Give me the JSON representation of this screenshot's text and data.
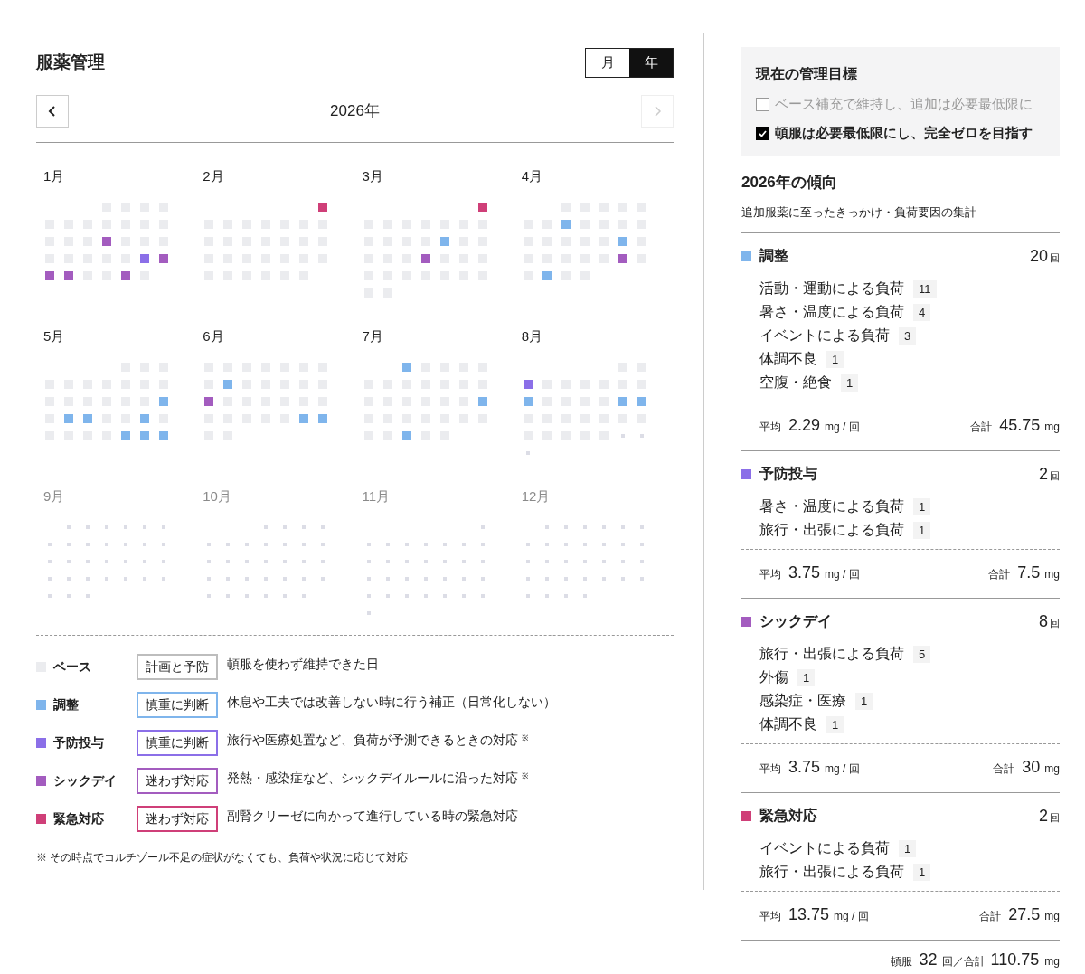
{
  "title": "服薬管理",
  "view_toggle": [
    {
      "label": "月",
      "selected": false
    },
    {
      "label": "年",
      "selected": true
    }
  ],
  "year_nav": {
    "label": "2026年",
    "prev_disabled": false,
    "next_disabled": true
  },
  "months": [
    {
      "label": "1月",
      "future": false,
      "days": [
        {
          "kind": "blank"
        },
        {
          "kind": "blank"
        },
        {
          "kind": "blank"
        },
        {
          "kind": "base"
        },
        {
          "kind": "base"
        },
        {
          "kind": "base"
        },
        {
          "kind": "base"
        },
        {
          "kind": "base"
        },
        {
          "kind": "base"
        },
        {
          "kind": "base"
        },
        {
          "kind": "base"
        },
        {
          "kind": "base"
        },
        {
          "kind": "base"
        },
        {
          "kind": "base"
        },
        {
          "kind": "base"
        },
        {
          "kind": "base"
        },
        {
          "kind": "base"
        },
        {
          "kind": "sickday"
        },
        {
          "kind": "base"
        },
        {
          "kind": "base"
        },
        {
          "kind": "base"
        },
        {
          "kind": "base"
        },
        {
          "kind": "base"
        },
        {
          "kind": "base"
        },
        {
          "kind": "base"
        },
        {
          "kind": "base"
        },
        {
          "kind": "prevention"
        },
        {
          "kind": "sickday"
        },
        {
          "kind": "sickday"
        },
        {
          "kind": "sickday"
        },
        {
          "kind": "base"
        },
        {
          "kind": "base"
        },
        {
          "kind": "sickday"
        },
        {
          "kind": "base"
        }
      ]
    },
    {
      "label": "2月",
      "future": false,
      "days": [
        {
          "kind": "blank"
        },
        {
          "kind": "blank"
        },
        {
          "kind": "blank"
        },
        {
          "kind": "blank"
        },
        {
          "kind": "blank"
        },
        {
          "kind": "blank"
        },
        {
          "kind": "emergency"
        },
        {
          "kind": "base"
        },
        {
          "kind": "base"
        },
        {
          "kind": "base"
        },
        {
          "kind": "base"
        },
        {
          "kind": "base"
        },
        {
          "kind": "base"
        },
        {
          "kind": "base"
        },
        {
          "kind": "base"
        },
        {
          "kind": "base"
        },
        {
          "kind": "base"
        },
        {
          "kind": "base"
        },
        {
          "kind": "base"
        },
        {
          "kind": "base"
        },
        {
          "kind": "base"
        },
        {
          "kind": "base"
        },
        {
          "kind": "base"
        },
        {
          "kind": "base"
        },
        {
          "kind": "base"
        },
        {
          "kind": "base"
        },
        {
          "kind": "base"
        },
        {
          "kind": "base"
        },
        {
          "kind": "base"
        },
        {
          "kind": "base"
        },
        {
          "kind": "base"
        },
        {
          "kind": "base"
        },
        {
          "kind": "base"
        },
        {
          "kind": "base"
        }
      ]
    },
    {
      "label": "3月",
      "future": false,
      "days": [
        {
          "kind": "blank"
        },
        {
          "kind": "blank"
        },
        {
          "kind": "blank"
        },
        {
          "kind": "blank"
        },
        {
          "kind": "blank"
        },
        {
          "kind": "blank"
        },
        {
          "kind": "emergency"
        },
        {
          "kind": "base"
        },
        {
          "kind": "base"
        },
        {
          "kind": "base"
        },
        {
          "kind": "base"
        },
        {
          "kind": "base"
        },
        {
          "kind": "base"
        },
        {
          "kind": "base"
        },
        {
          "kind": "base"
        },
        {
          "kind": "base"
        },
        {
          "kind": "base"
        },
        {
          "kind": "base"
        },
        {
          "kind": "adjust"
        },
        {
          "kind": "base"
        },
        {
          "kind": "base"
        },
        {
          "kind": "base"
        },
        {
          "kind": "base"
        },
        {
          "kind": "base"
        },
        {
          "kind": "sickday"
        },
        {
          "kind": "base"
        },
        {
          "kind": "base"
        },
        {
          "kind": "base"
        },
        {
          "kind": "base"
        },
        {
          "kind": "base"
        },
        {
          "kind": "base"
        },
        {
          "kind": "base"
        },
        {
          "kind": "base"
        },
        {
          "kind": "base"
        },
        {
          "kind": "base"
        },
        {
          "kind": "base"
        },
        {
          "kind": "base"
        }
      ]
    },
    {
      "label": "4月",
      "future": false,
      "days": [
        {
          "kind": "blank"
        },
        {
          "kind": "blank"
        },
        {
          "kind": "base"
        },
        {
          "kind": "base"
        },
        {
          "kind": "base"
        },
        {
          "kind": "base"
        },
        {
          "kind": "base"
        },
        {
          "kind": "base"
        },
        {
          "kind": "base"
        },
        {
          "kind": "adjust"
        },
        {
          "kind": "base"
        },
        {
          "kind": "base"
        },
        {
          "kind": "base"
        },
        {
          "kind": "base"
        },
        {
          "kind": "base"
        },
        {
          "kind": "base"
        },
        {
          "kind": "base"
        },
        {
          "kind": "base"
        },
        {
          "kind": "base"
        },
        {
          "kind": "adjust"
        },
        {
          "kind": "base"
        },
        {
          "kind": "base"
        },
        {
          "kind": "base"
        },
        {
          "kind": "base"
        },
        {
          "kind": "base"
        },
        {
          "kind": "base"
        },
        {
          "kind": "sickday"
        },
        {
          "kind": "base"
        },
        {
          "kind": "base"
        },
        {
          "kind": "adjust"
        },
        {
          "kind": "base"
        },
        {
          "kind": "base"
        }
      ]
    },
    {
      "label": "5月",
      "future": false,
      "days": [
        {
          "kind": "blank"
        },
        {
          "kind": "blank"
        },
        {
          "kind": "blank"
        },
        {
          "kind": "blank"
        },
        {
          "kind": "base"
        },
        {
          "kind": "base"
        },
        {
          "kind": "base"
        },
        {
          "kind": "base"
        },
        {
          "kind": "base"
        },
        {
          "kind": "base"
        },
        {
          "kind": "base"
        },
        {
          "kind": "base"
        },
        {
          "kind": "base"
        },
        {
          "kind": "base"
        },
        {
          "kind": "base"
        },
        {
          "kind": "base"
        },
        {
          "kind": "base"
        },
        {
          "kind": "base"
        },
        {
          "kind": "base"
        },
        {
          "kind": "base"
        },
        {
          "kind": "adjust"
        },
        {
          "kind": "base"
        },
        {
          "kind": "adjust"
        },
        {
          "kind": "adjust"
        },
        {
          "kind": "base"
        },
        {
          "kind": "base"
        },
        {
          "kind": "adjust"
        },
        {
          "kind": "base"
        },
        {
          "kind": "base"
        },
        {
          "kind": "base"
        },
        {
          "kind": "base"
        },
        {
          "kind": "base"
        },
        {
          "kind": "adjust"
        },
        {
          "kind": "adjust"
        },
        {
          "kind": "adjust"
        }
      ]
    },
    {
      "label": "6月",
      "future": false,
      "days": [
        {
          "kind": "base"
        },
        {
          "kind": "base"
        },
        {
          "kind": "base"
        },
        {
          "kind": "base"
        },
        {
          "kind": "base"
        },
        {
          "kind": "base"
        },
        {
          "kind": "base"
        },
        {
          "kind": "base"
        },
        {
          "kind": "adjust"
        },
        {
          "kind": "base"
        },
        {
          "kind": "base"
        },
        {
          "kind": "base"
        },
        {
          "kind": "base"
        },
        {
          "kind": "base"
        },
        {
          "kind": "sickday"
        },
        {
          "kind": "base"
        },
        {
          "kind": "base"
        },
        {
          "kind": "base"
        },
        {
          "kind": "base"
        },
        {
          "kind": "base"
        },
        {
          "kind": "base"
        },
        {
          "kind": "base"
        },
        {
          "kind": "base"
        },
        {
          "kind": "base"
        },
        {
          "kind": "base"
        },
        {
          "kind": "base"
        },
        {
          "kind": "adjust"
        },
        {
          "kind": "adjust"
        },
        {
          "kind": "base"
        },
        {
          "kind": "base"
        }
      ]
    },
    {
      "label": "7月",
      "future": false,
      "days": [
        {
          "kind": "blank"
        },
        {
          "kind": "blank"
        },
        {
          "kind": "adjust"
        },
        {
          "kind": "base"
        },
        {
          "kind": "base"
        },
        {
          "kind": "base"
        },
        {
          "kind": "base"
        },
        {
          "kind": "base"
        },
        {
          "kind": "base"
        },
        {
          "kind": "base"
        },
        {
          "kind": "base"
        },
        {
          "kind": "base"
        },
        {
          "kind": "base"
        },
        {
          "kind": "base"
        },
        {
          "kind": "base"
        },
        {
          "kind": "base"
        },
        {
          "kind": "base"
        },
        {
          "kind": "base"
        },
        {
          "kind": "base"
        },
        {
          "kind": "base"
        },
        {
          "kind": "adjust"
        },
        {
          "kind": "base"
        },
        {
          "kind": "base"
        },
        {
          "kind": "base"
        },
        {
          "kind": "base"
        },
        {
          "kind": "base"
        },
        {
          "kind": "base"
        },
        {
          "kind": "base"
        },
        {
          "kind": "base"
        },
        {
          "kind": "base"
        },
        {
          "kind": "adjust"
        },
        {
          "kind": "base"
        },
        {
          "kind": "base"
        }
      ]
    },
    {
      "label": "8月",
      "future": false,
      "days": [
        {
          "kind": "blank"
        },
        {
          "kind": "blank"
        },
        {
          "kind": "blank"
        },
        {
          "kind": "blank"
        },
        {
          "kind": "blank"
        },
        {
          "kind": "base"
        },
        {
          "kind": "base"
        },
        {
          "kind": "prevention"
        },
        {
          "kind": "base"
        },
        {
          "kind": "base"
        },
        {
          "kind": "base"
        },
        {
          "kind": "base"
        },
        {
          "kind": "base"
        },
        {
          "kind": "base"
        },
        {
          "kind": "adjust"
        },
        {
          "kind": "base"
        },
        {
          "kind": "base"
        },
        {
          "kind": "base"
        },
        {
          "kind": "base"
        },
        {
          "kind": "adjust"
        },
        {
          "kind": "adjust"
        },
        {
          "kind": "base"
        },
        {
          "kind": "base"
        },
        {
          "kind": "base"
        },
        {
          "kind": "base"
        },
        {
          "kind": "base"
        },
        {
          "kind": "base"
        },
        {
          "kind": "base"
        },
        {
          "kind": "base"
        },
        {
          "kind": "base"
        },
        {
          "kind": "base"
        },
        {
          "kind": "base"
        },
        {
          "kind": "base"
        },
        {
          "kind": "future"
        },
        {
          "kind": "future"
        },
        {
          "kind": "future"
        }
      ]
    },
    {
      "label": "9月",
      "future": true,
      "days": [
        {
          "kind": "blank"
        },
        {
          "kind": "future"
        },
        {
          "kind": "future"
        },
        {
          "kind": "future"
        },
        {
          "kind": "future"
        },
        {
          "kind": "future"
        },
        {
          "kind": "future"
        },
        {
          "kind": "future"
        },
        {
          "kind": "future"
        },
        {
          "kind": "future"
        },
        {
          "kind": "future"
        },
        {
          "kind": "future"
        },
        {
          "kind": "future"
        },
        {
          "kind": "future"
        },
        {
          "kind": "future"
        },
        {
          "kind": "future"
        },
        {
          "kind": "future"
        },
        {
          "kind": "future"
        },
        {
          "kind": "future"
        },
        {
          "kind": "future"
        },
        {
          "kind": "future"
        },
        {
          "kind": "future"
        },
        {
          "kind": "future"
        },
        {
          "kind": "future"
        },
        {
          "kind": "future"
        },
        {
          "kind": "future"
        },
        {
          "kind": "future"
        },
        {
          "kind": "future"
        },
        {
          "kind": "future"
        },
        {
          "kind": "future"
        },
        {
          "kind": "future"
        }
      ]
    },
    {
      "label": "10月",
      "future": true,
      "days": [
        {
          "kind": "blank"
        },
        {
          "kind": "blank"
        },
        {
          "kind": "blank"
        },
        {
          "kind": "future"
        },
        {
          "kind": "future"
        },
        {
          "kind": "future"
        },
        {
          "kind": "future"
        },
        {
          "kind": "future"
        },
        {
          "kind": "future"
        },
        {
          "kind": "future"
        },
        {
          "kind": "future"
        },
        {
          "kind": "future"
        },
        {
          "kind": "future"
        },
        {
          "kind": "future"
        },
        {
          "kind": "future"
        },
        {
          "kind": "future"
        },
        {
          "kind": "future"
        },
        {
          "kind": "future"
        },
        {
          "kind": "future"
        },
        {
          "kind": "future"
        },
        {
          "kind": "future"
        },
        {
          "kind": "future"
        },
        {
          "kind": "future"
        },
        {
          "kind": "future"
        },
        {
          "kind": "future"
        },
        {
          "kind": "future"
        },
        {
          "kind": "future"
        },
        {
          "kind": "future"
        },
        {
          "kind": "future"
        },
        {
          "kind": "future"
        },
        {
          "kind": "future"
        },
        {
          "kind": "future"
        },
        {
          "kind": "future"
        },
        {
          "kind": "future"
        }
      ]
    },
    {
      "label": "11月",
      "future": true,
      "days": [
        {
          "kind": "blank"
        },
        {
          "kind": "blank"
        },
        {
          "kind": "blank"
        },
        {
          "kind": "blank"
        },
        {
          "kind": "blank"
        },
        {
          "kind": "blank"
        },
        {
          "kind": "future"
        },
        {
          "kind": "future"
        },
        {
          "kind": "future"
        },
        {
          "kind": "future"
        },
        {
          "kind": "future"
        },
        {
          "kind": "future"
        },
        {
          "kind": "future"
        },
        {
          "kind": "future"
        },
        {
          "kind": "future"
        },
        {
          "kind": "future"
        },
        {
          "kind": "future"
        },
        {
          "kind": "future"
        },
        {
          "kind": "future"
        },
        {
          "kind": "future"
        },
        {
          "kind": "future"
        },
        {
          "kind": "future"
        },
        {
          "kind": "future"
        },
        {
          "kind": "future"
        },
        {
          "kind": "future"
        },
        {
          "kind": "future"
        },
        {
          "kind": "future"
        },
        {
          "kind": "future"
        },
        {
          "kind": "future"
        },
        {
          "kind": "future"
        },
        {
          "kind": "future"
        },
        {
          "kind": "future"
        },
        {
          "kind": "future"
        },
        {
          "kind": "future"
        },
        {
          "kind": "future"
        },
        {
          "kind": "future"
        }
      ]
    },
    {
      "label": "12月",
      "future": true,
      "days": [
        {
          "kind": "blank"
        },
        {
          "kind": "future"
        },
        {
          "kind": "future"
        },
        {
          "kind": "future"
        },
        {
          "kind": "future"
        },
        {
          "kind": "future"
        },
        {
          "kind": "future"
        },
        {
          "kind": "future"
        },
        {
          "kind": "future"
        },
        {
          "kind": "future"
        },
        {
          "kind": "future"
        },
        {
          "kind": "future"
        },
        {
          "kind": "future"
        },
        {
          "kind": "future"
        },
        {
          "kind": "future"
        },
        {
          "kind": "future"
        },
        {
          "kind": "future"
        },
        {
          "kind": "future"
        },
        {
          "kind": "future"
        },
        {
          "kind": "future"
        },
        {
          "kind": "future"
        },
        {
          "kind": "future"
        },
        {
          "kind": "future"
        },
        {
          "kind": "future"
        },
        {
          "kind": "future"
        },
        {
          "kind": "future"
        },
        {
          "kind": "future"
        },
        {
          "kind": "future"
        },
        {
          "kind": "future"
        },
        {
          "kind": "future"
        },
        {
          "kind": "future"
        },
        {
          "kind": "future"
        }
      ]
    }
  ],
  "legend": [
    {
      "kind": "base",
      "label": "ベース",
      "color": "#ebecef",
      "badge": "計画と予防",
      "description": "頓服を使わず維持できた日"
    },
    {
      "kind": "adjust",
      "label": "調整",
      "color": "#7fb5ec",
      "badge": "慎重に判断",
      "description": "休息や工夫では改善しない時に行う補正（日常化しない）"
    },
    {
      "kind": "prevention",
      "label": "予防投与",
      "color": "#8b6fe8",
      "badge": "慎重に判断",
      "description": "旅行や医療処置など、負荷が予測できるときの対応 $^{※}$"
    },
    {
      "kind": "sickday",
      "label": "シックデイ",
      "color": "#a35cbf",
      "badge": "迷わず対応",
      "description": "発熱・感染症など、シックデイルールに沿った対応 $^{※}$"
    },
    {
      "kind": "emergency",
      "label": "緊急対応",
      "color": "#cf3f78",
      "badge": "迷わず対応",
      "description": "副腎クリーゼに向かって進行している時の緊急対応"
    }
  ],
  "footnote": "※ その時点でコルチゾール不足の症状がなくても、負荷や状況に応じて対応",
  "goals": {
    "title": "現在の管理目標",
    "items": [
      {
        "label": "ベース補充で維持し、追加は必要最低限に",
        "checked": false
      },
      {
        "label": "頓服は必要最低限にし、完全ゼロを目指す",
        "checked": true
      }
    ]
  },
  "trend": {
    "title": "2026年の傾向",
    "subtitle": "追加服薬に至ったきっかけ・負荷要因の集計"
  },
  "categories": [
    {
      "name": "調整",
      "color": "#7fb5ec",
      "count": "20",
      "count_unit": "回",
      "reasons": [
        {
          "label": "活動・運動による負荷",
          "count": "11"
        },
        {
          "label": "暑さ・温度による負荷",
          "count": "4"
        },
        {
          "label": "イベントによる負荷",
          "count": "3"
        },
        {
          "label": "体調不良",
          "count": "1"
        },
        {
          "label": "空腹・絶食",
          "count": "1"
        }
      ],
      "avg_label": "平均",
      "avg": "2.29",
      "avg_unit": "mg / 回",
      "total_label": "合計",
      "total": "45.75",
      "total_unit": "mg"
    },
    {
      "name": "予防投与",
      "color": "#8b6fe8",
      "count": "2",
      "count_unit": "回",
      "reasons": [
        {
          "label": "暑さ・温度による負荷",
          "count": "1"
        },
        {
          "label": "旅行・出張による負荷",
          "count": "1"
        }
      ],
      "avg_label": "平均",
      "avg": "3.75",
      "avg_unit": "mg / 回",
      "total_label": "合計",
      "total": "7.5",
      "total_unit": "mg"
    },
    {
      "name": "シックデイ",
      "color": "#a35cbf",
      "count": "8",
      "count_unit": "回",
      "reasons": [
        {
          "label": "旅行・出張による負荷",
          "count": "5"
        },
        {
          "label": "外傷",
          "count": "1"
        },
        {
          "label": "感染症・医療",
          "count": "1"
        },
        {
          "label": "体調不良",
          "count": "1"
        }
      ],
      "avg_label": "平均",
      "avg": "3.75",
      "avg_unit": "mg / 回",
      "total_label": "合計",
      "total": "30",
      "total_unit": "mg"
    },
    {
      "name": "緊急対応",
      "color": "#cf3f78",
      "count": "2",
      "count_unit": "回",
      "reasons": [
        {
          "label": "イベントによる負荷",
          "count": "1"
        },
        {
          "label": "旅行・出張による負荷",
          "count": "1"
        }
      ],
      "avg_label": "平均",
      "avg": "13.75",
      "avg_unit": "mg / 回",
      "total_label": "合計",
      "total": "27.5",
      "total_unit": "mg"
    }
  ],
  "grand_total": {
    "label": "頓服",
    "count": "32",
    "middle": "回／合計",
    "total": "110.75",
    "unit": "mg"
  }
}
